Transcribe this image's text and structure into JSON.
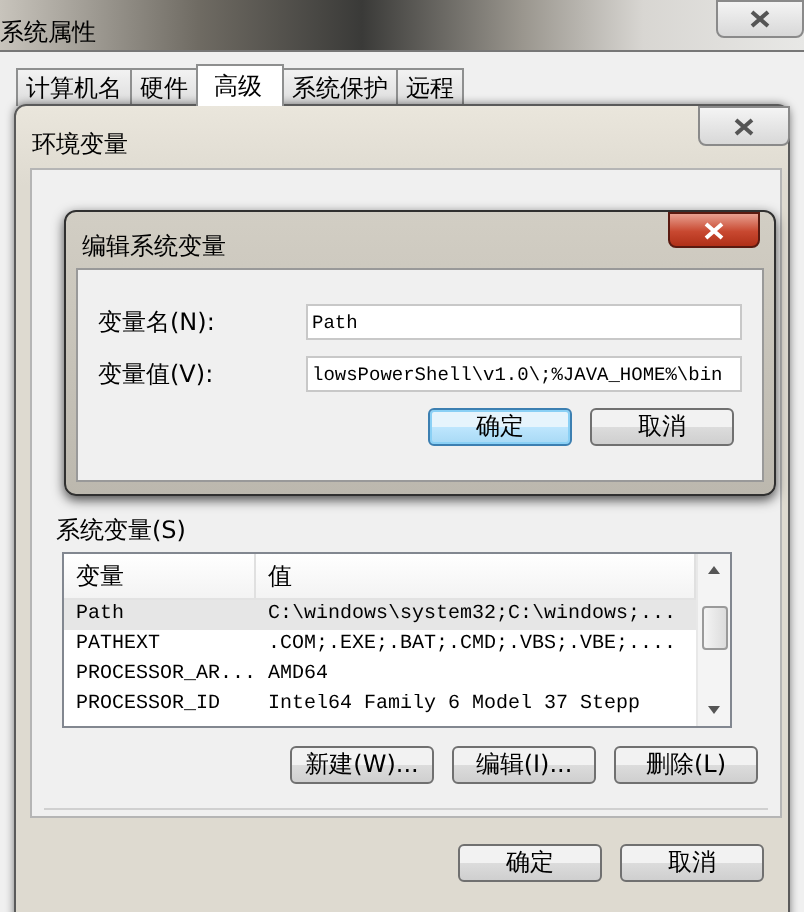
{
  "system_properties": {
    "title": "系统属性",
    "tabs": [
      {
        "label": "计算机名",
        "selected": false
      },
      {
        "label": "硬件",
        "selected": false
      },
      {
        "label": "高级",
        "selected": true
      },
      {
        "label": "系统保护",
        "selected": false
      },
      {
        "label": "远程",
        "selected": false
      }
    ]
  },
  "environment_variables": {
    "title": "环境变量",
    "system_variables": {
      "label": "系统变量(S)",
      "columns": [
        "变量",
        "值"
      ],
      "rows": [
        {
          "name": "Path",
          "value": "C:\\windows\\system32;C:\\windows;...",
          "selected": true
        },
        {
          "name": "PATHEXT",
          "value": ".COM;.EXE;.BAT;.CMD;.VBS;.VBE;....",
          "selected": false
        },
        {
          "name": "PROCESSOR_AR...",
          "value": "AMD64",
          "selected": false
        },
        {
          "name": "PROCESSOR_ID",
          "value": "Intel64 Family 6 Model 37 Stepp",
          "selected": false
        }
      ],
      "buttons": [
        "新建(W)...",
        "编辑(I)...",
        "删除(L)"
      ]
    },
    "buttons": [
      "确定",
      "取消"
    ]
  },
  "edit_dialog": {
    "title": "编辑系统变量",
    "fields": [
      {
        "label": "变量名(N):",
        "value": "Path"
      },
      {
        "label": "变量值(V):",
        "value": "lowsPowerShell\\v1.0\\;%JAVA_HOME%\\bin"
      }
    ],
    "buttons": [
      {
        "label": "确定",
        "default": true
      },
      {
        "label": "取消",
        "default": false
      }
    ]
  }
}
